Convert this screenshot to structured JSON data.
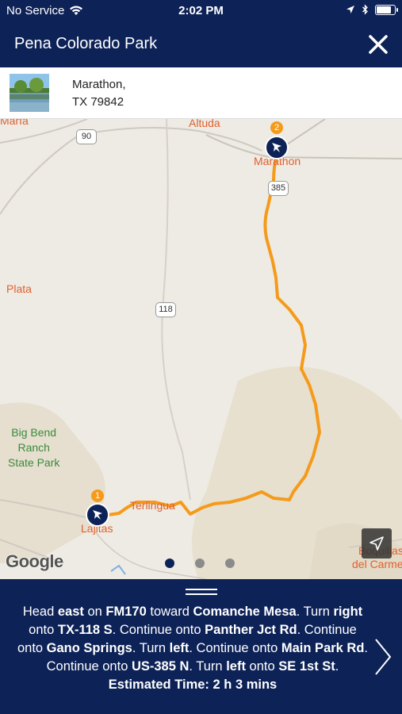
{
  "status": {
    "carrier": "No Service",
    "time": "2:02 PM",
    "battery_level": 0.92
  },
  "header": {
    "title": "Pena Colorado Park"
  },
  "address": {
    "line1": "Marathon,",
    "line2": "TX 79842"
  },
  "map": {
    "places": {
      "marfa": "Marfa",
      "altuda": "Altuda",
      "marathon": "Marathon",
      "plata": "Plata",
      "terlingua": "Terlingua",
      "lajitas": "Lajitas",
      "boquillas_1": "Boquillas",
      "boquillas_2": "del Carmen"
    },
    "park": {
      "line1": "Big Bend",
      "line2": "Ranch",
      "line3": "State Park"
    },
    "shields": {
      "us90": "90",
      "us385": "385",
      "tx118": "118"
    },
    "pins": {
      "start_number": "1",
      "end_number": "2"
    },
    "attribution": "Google",
    "page_count": 3,
    "active_page": 1,
    "route_color": "#f59a1a"
  },
  "directions": {
    "segments": [
      {
        "t": "Head "
      },
      {
        "t": "east",
        "b": true
      },
      {
        "t": " on "
      },
      {
        "t": "FM170",
        "b": true
      },
      {
        "t": " toward "
      },
      {
        "t": "Comanche Mesa",
        "b": true
      },
      {
        "t": ". Turn "
      },
      {
        "t": "right",
        "b": true
      },
      {
        "t": " onto "
      },
      {
        "t": "TX-118 S",
        "b": true
      },
      {
        "t": ". Continue onto "
      },
      {
        "t": "Panther Jct Rd",
        "b": true
      },
      {
        "t": ". Continue onto "
      },
      {
        "t": "Gano Springs",
        "b": true
      },
      {
        "t": ". Turn "
      },
      {
        "t": "left",
        "b": true
      },
      {
        "t": ". Continue onto "
      },
      {
        "t": "Main Park Rd",
        "b": true
      },
      {
        "t": ". Continue onto "
      },
      {
        "t": "US-385 N",
        "b": true
      },
      {
        "t": ". Turn "
      },
      {
        "t": "left",
        "b": true
      },
      {
        "t": " onto "
      },
      {
        "t": "SE 1st St",
        "b": true
      },
      {
        "t": "."
      }
    ],
    "estimated": "Estimated Time: 2 h 3 mins"
  },
  "colors": {
    "navy": "#0d2257",
    "accent_orange": "#f59a1a",
    "place_label": "#e0602e"
  }
}
